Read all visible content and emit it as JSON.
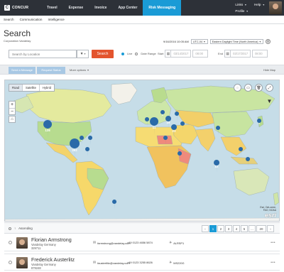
{
  "topbar": {
    "logo_text": "CONCUR",
    "nav": [
      "Travel",
      "Expense",
      "Invoice",
      "App Center",
      "Risk Messaging"
    ],
    "active_nav": "Risk Messaging",
    "links_label": "Links",
    "help_label": "Help",
    "profile_label": "Profile"
  },
  "subnav": [
    "Search",
    "Communication",
    "Intelligence"
  ],
  "page": {
    "title": "Search",
    "company": "Corporation Vandelay",
    "datetime": "9/16/2016 10:05 AM",
    "utc": "UTC-04",
    "timezone": "Eastern Daylight Time (North America)"
  },
  "search": {
    "placeholder": "Search by Location",
    "filter_icon": "funnel-icon",
    "button_label": "Search",
    "radio_live": "Live",
    "radio_range": "Date Range",
    "start_label": "Start",
    "start_date": "03/14/2017",
    "start_time": "08:00",
    "end_label": "End",
    "end_date": "03/17/2017",
    "end_time": "08:00"
  },
  "actions": {
    "send_message": "Send a Message",
    "request_status": "Request Status",
    "more_options": "More options",
    "hide_map": "Hide Map"
  },
  "map": {
    "tabs": [
      "Road",
      "Satellite",
      "Hybrid"
    ],
    "active_tab": "Road",
    "zoom_in": "+",
    "zoom_out": "−",
    "attribution_1": "Esri, DeLorme,",
    "attribution_2": "FAO, NOAA",
    "attribution_logo": "esri",
    "cluster_labels": [
      "128",
      "262",
      "11",
      "18",
      "23",
      "12",
      "1",
      "2",
      "4"
    ]
  },
  "list": {
    "sort_label": "Ascending",
    "pages": [
      "1",
      "2",
      "3",
      "4",
      "5",
      "...",
      "20"
    ],
    "active_page": "1",
    "rows": [
      {
        "name": "Florian Armstrong",
        "org": "Vandelay Germany",
        "id": "329711",
        "email": "farmstrong@vandelay.com",
        "phone": "+49 0123 4656 5874",
        "flight": "ALRSP1"
      },
      {
        "name": "Frederick Austerlitz",
        "org": "Vandelay Germany",
        "id": "879248",
        "email": "faustertlitz@vandelay.com",
        "phone": "+49 0123 3255 8626",
        "flight": "MS220G"
      }
    ]
  },
  "colors": {
    "topbar": "#2d3138",
    "accent": "#1a9bd6",
    "search_button": "#e3542e",
    "marker": "#2a6aa8"
  }
}
